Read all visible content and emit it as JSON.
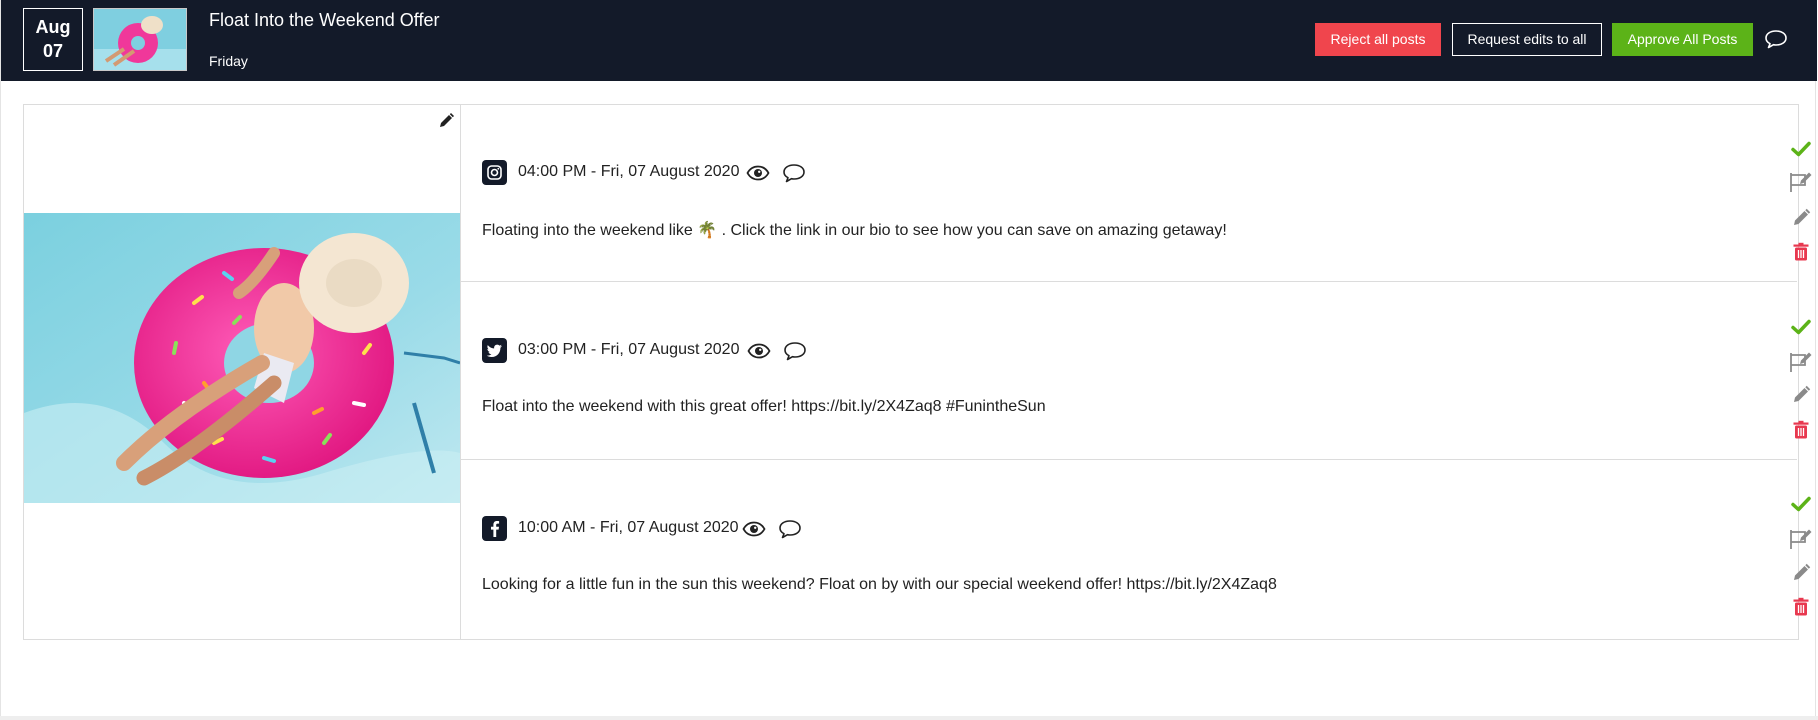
{
  "header": {
    "date_month": "Aug",
    "date_day": "07",
    "title": "Float Into the Weekend Offer",
    "weekday": "Friday",
    "reject_label": "Reject all posts",
    "request_label": "Request edits to all",
    "approve_label": "Approve All Posts"
  },
  "colors": {
    "header_bg": "#131a29",
    "reject": "#f0454d",
    "approve": "#5cb318",
    "delete": "#e8384f"
  },
  "posts": [
    {
      "network": "instagram",
      "icon": "instagram-icon",
      "time": "04:00 PM - Fri, 07 August 2020",
      "text": "Floating into the weekend like 🌴 . Click the link in our bio to see how you can save on amazing getaway!"
    },
    {
      "network": "twitter",
      "icon": "twitter-icon",
      "time": "03:00 PM - Fri, 07 August 2020",
      "text": "Float into the weekend with this great offer! https://bit.ly/2X4Zaq8 #FunintheSun"
    },
    {
      "network": "facebook",
      "icon": "facebook-icon",
      "time": "10:00 AM - Fri, 07 August 2020",
      "text": "Looking for a little fun in the sun this weekend? Float on by with our special weekend offer! https://bit.ly/2X4Zaq8"
    }
  ],
  "post_actions": [
    "check-icon",
    "request-edit-icon",
    "pencil-icon",
    "trash-icon"
  ]
}
